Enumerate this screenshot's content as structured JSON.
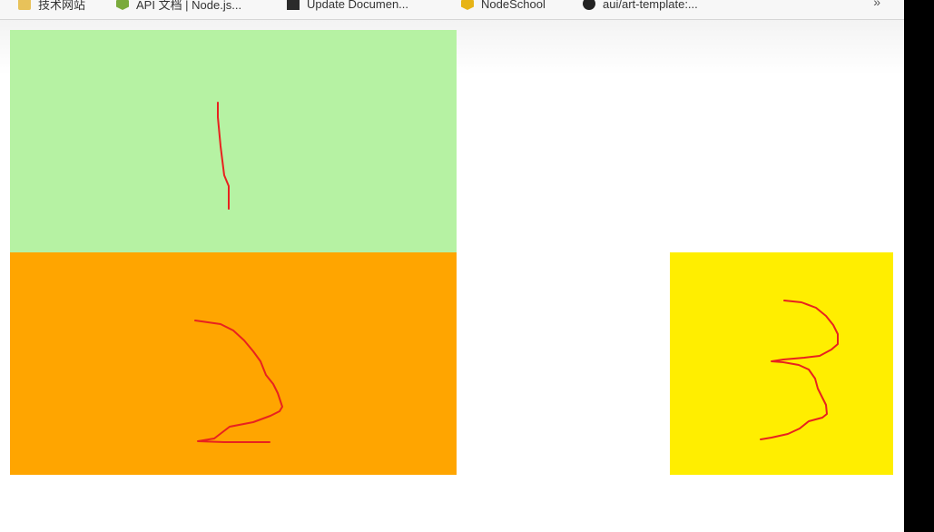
{
  "bookmarks": {
    "items": [
      {
        "label": "技术网站",
        "icon": "folder-icon"
      },
      {
        "label": "API 文档 | Node.js...",
        "icon": "nodejs-icon"
      },
      {
        "label": "Update Documen...",
        "icon": "update-document-icon"
      },
      {
        "label": "NodeSchool",
        "icon": "nodeschool-icon"
      },
      {
        "label": "aui/art-template:...",
        "icon": "github-icon"
      }
    ],
    "more_label": "»"
  },
  "boxes": {
    "box1": {
      "color": "#b6f2a3",
      "annotation": "1"
    },
    "box2": {
      "color": "#ffa500",
      "annotation": "2"
    },
    "box3": {
      "color": "#ffee00",
      "annotation": "3"
    }
  },
  "annotation_color": "#e8221f"
}
